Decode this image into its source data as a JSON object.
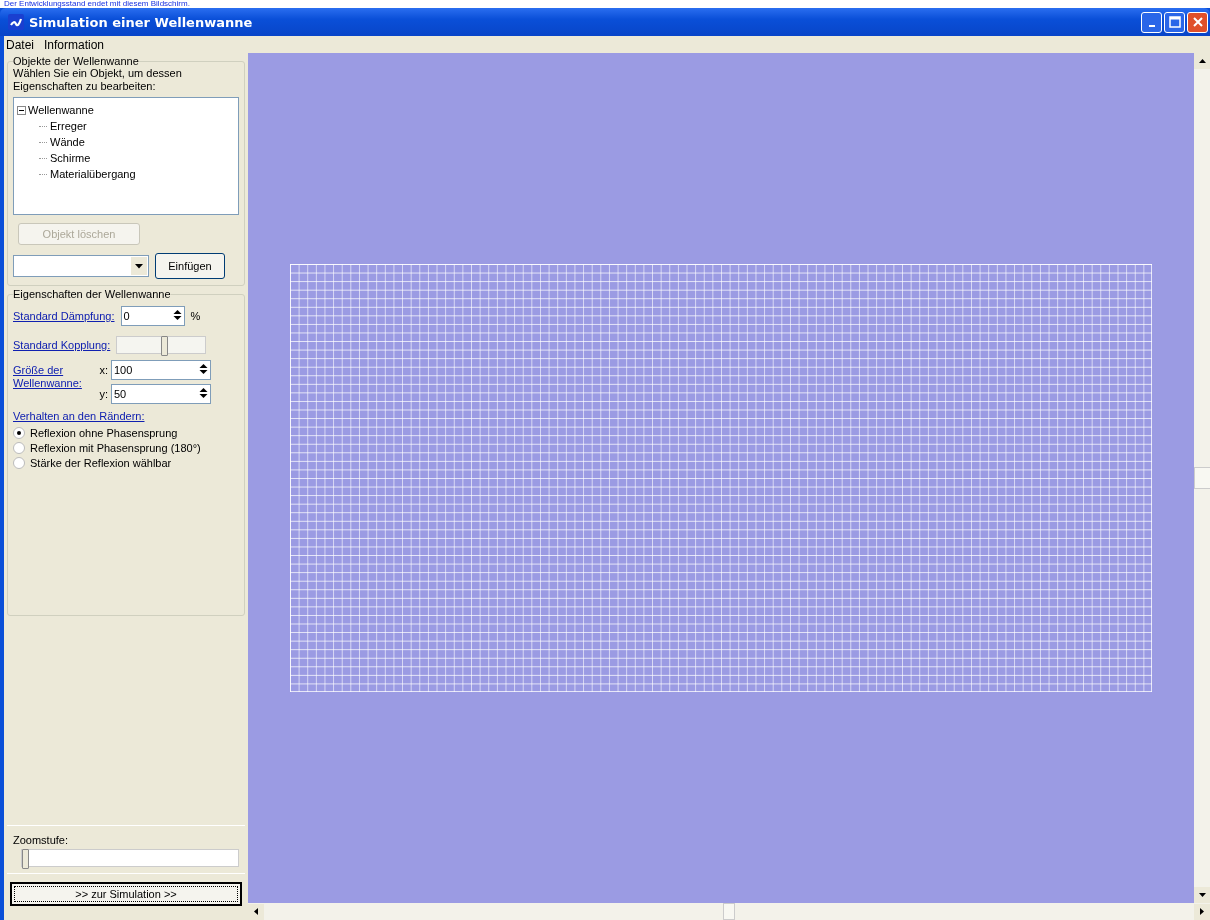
{
  "caption": "Der Entwicklungsstand endet mit diesem Bildschirm.",
  "window": {
    "title": "Simulation einer Wellenwanne"
  },
  "menu": [
    "Datei",
    "Information"
  ],
  "objects": {
    "title": "Objekte der Wellenwanne",
    "instruction": "Wählen Sie ein Objekt, um dessen Eigenschaften zu bearbeiten:",
    "tree": [
      {
        "label": "Wellenwanne",
        "expanded": true,
        "children": [
          {
            "label": "Erreger"
          },
          {
            "label": "Wände"
          },
          {
            "label": "Schirme"
          },
          {
            "label": "Materialübergang"
          }
        ]
      }
    ],
    "delete_button": {
      "label": "Objekt löschen",
      "disabled": true
    },
    "insert_button": {
      "label": "Einfügen",
      "disabled": false
    }
  },
  "properties": {
    "title": "Eigenschaften der Wellenwanne",
    "damping": {
      "label": "Standard Dämpfung:",
      "value": "0",
      "unit": "%"
    },
    "coupling": {
      "label": "Standard Kopplung:",
      "level": 0.55
    },
    "size": {
      "label": "Größe der Wellenwanne:",
      "x_label": "x:",
      "x_value": "100",
      "y_label": "y:",
      "y_value": "50"
    },
    "boundary": {
      "label": "Verhalten an den Rändern:",
      "options": [
        {
          "label": "Reflexion ohne Phasensprung",
          "selected": true
        },
        {
          "label": "Reflexion mit Phasensprung (180°)",
          "selected": false
        },
        {
          "label": "Stärke der Reflexion wählbar",
          "selected": false
        }
      ]
    }
  },
  "zoom": {
    "label": "Zoomstufe:",
    "level": 0.0
  },
  "simulate_button": {
    "label": ">> zur Simulation >>"
  }
}
